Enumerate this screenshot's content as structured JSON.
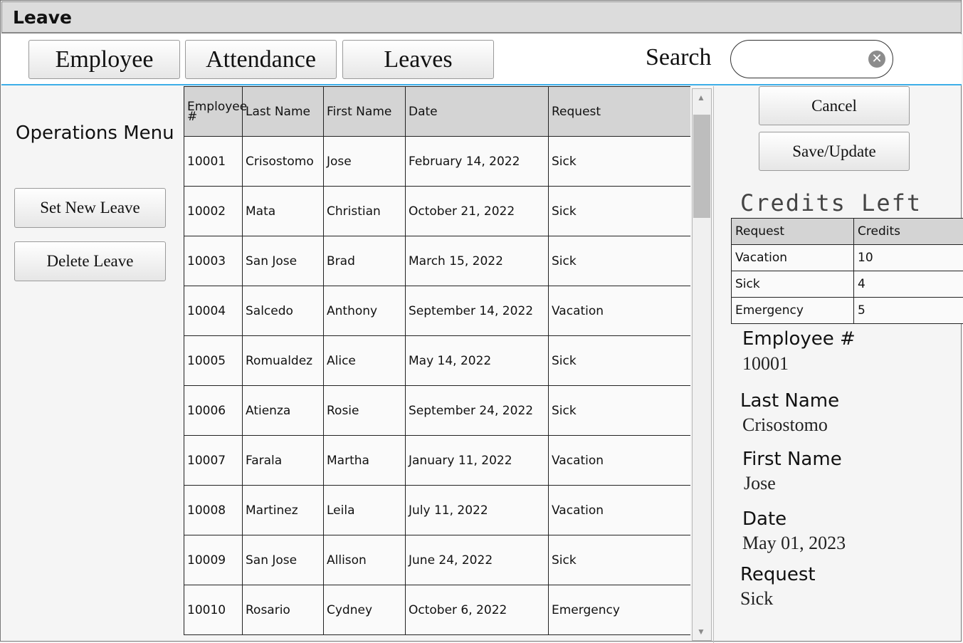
{
  "window": {
    "title": "Leave"
  },
  "nav": {
    "tabs": [
      {
        "label": "Employee"
      },
      {
        "label": "Attendance"
      },
      {
        "label": "Leaves"
      }
    ],
    "search_label": "Search",
    "search_value": ""
  },
  "sidebar": {
    "title": "Operations Menu",
    "set_new_leave": "Set New Leave",
    "delete_leave": "Delete Leave"
  },
  "table": {
    "headers": [
      "Employee #",
      "Last Name",
      "First Name",
      "Date",
      "Request"
    ],
    "rows": [
      [
        "10001",
        "Crisostomo",
        "Jose",
        "February 14, 2022",
        "Sick"
      ],
      [
        "10002",
        "Mata",
        "Christian",
        "October 21, 2022",
        "Sick"
      ],
      [
        "10003",
        "San Jose",
        "Brad",
        "March 15, 2022",
        "Sick"
      ],
      [
        "10004",
        "Salcedo",
        "Anthony",
        "September 14, 2022",
        "Vacation"
      ],
      [
        "10005",
        "Romualdez",
        "Alice",
        "May 14, 2022",
        "Sick"
      ],
      [
        "10006",
        "Atienza",
        "Rosie",
        "September 24, 2022",
        "Sick"
      ],
      [
        "10007",
        "Farala",
        "Martha",
        "January 11, 2022",
        "Vacation"
      ],
      [
        "10008",
        "Martinez",
        "Leila",
        "July 11, 2022",
        "Vacation"
      ],
      [
        "10009",
        "San Jose",
        "Allison",
        "June 24, 2022",
        "Sick"
      ],
      [
        "10010",
        "Rosario",
        "Cydney",
        "October 6, 2022",
        "Emergency"
      ]
    ]
  },
  "actions": {
    "cancel": "Cancel",
    "save": "Save/Update"
  },
  "credits": {
    "title": "Credits Left",
    "headers": [
      "Request",
      "Credits"
    ],
    "rows": [
      [
        "Vacation",
        "10"
      ],
      [
        "Sick",
        "4"
      ],
      [
        "Emergency",
        "5"
      ]
    ]
  },
  "details": {
    "employee_label": "Employee #",
    "employee_value": "10001",
    "last_name_label": "Last Name",
    "last_name_value": "Crisostomo",
    "first_name_label": "First Name",
    "first_name_value": "Jose",
    "date_label": "Date",
    "date_value": "May 01, 2023",
    "request_label": "Request",
    "request_value": "Sick"
  },
  "colors": {
    "accent_line": "#3eaee8",
    "header_bg": "#d4d4d4",
    "titlebar_bg": "#dcdcdc"
  },
  "icons": {
    "search_clear": "clear-circle-x-icon"
  }
}
